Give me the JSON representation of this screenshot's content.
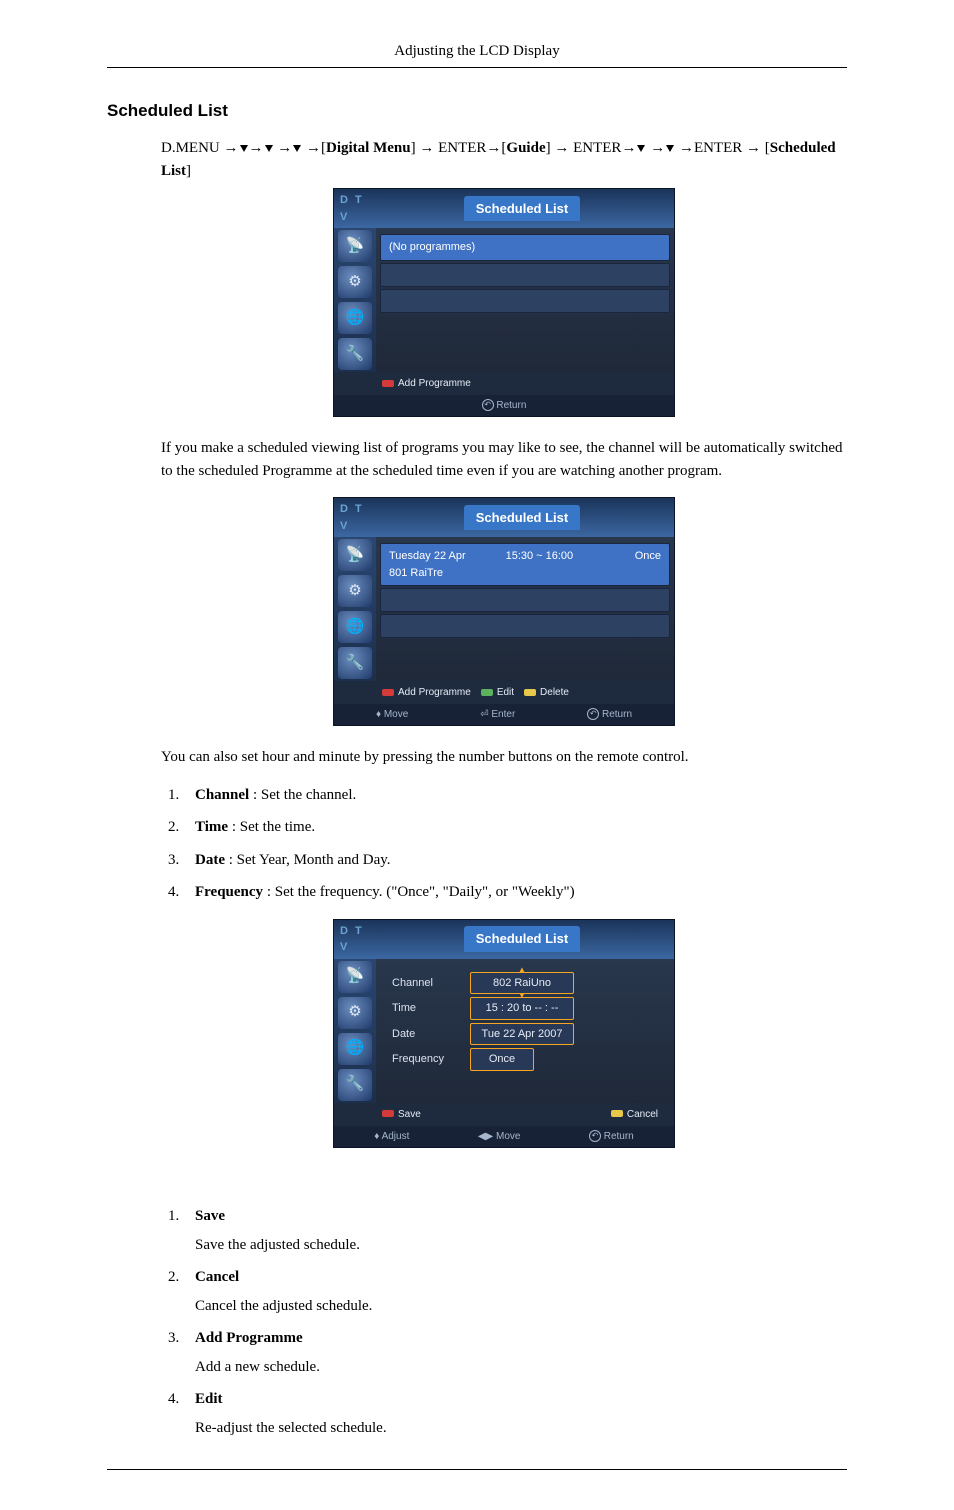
{
  "header": {
    "title": "Adjusting the LCD Display"
  },
  "section": {
    "title": "Scheduled List"
  },
  "breadcrumb": {
    "dmenu": "D.MENU ",
    "digital_menu": "Digital Menu",
    "enter": "ENTER",
    "guide": "Guide",
    "scheduled_list": "Scheduled List"
  },
  "osd_common": {
    "dtv": "D T V",
    "title": "Scheduled List",
    "icons": [
      "📡",
      "⚙",
      "🌐",
      "🔧"
    ]
  },
  "osd1": {
    "no_programmes": "(No programmes)",
    "add_programme": "Add Programme",
    "return": "Return"
  },
  "text1": "If you make a scheduled viewing list of programs you may like to see, the channel will be automatically switched to the scheduled Programme at the scheduled time even if you are watching another program.",
  "osd2": {
    "row": {
      "date": "Tuesday  22  Apr",
      "channel": "801  RaiTre",
      "time": "15:30 ~ 16:00",
      "freq": "Once"
    },
    "add_programme": "Add Programme",
    "edit": "Edit",
    "delete": "Delete",
    "move": "Move",
    "enter": "Enter",
    "return": "Return"
  },
  "text2": "You can also set hour and minute by pressing the number buttons on the remote control.",
  "list1": [
    {
      "label": "Channel",
      "desc": " : Set the channel."
    },
    {
      "label": "Time",
      "desc": " : Set the time."
    },
    {
      "label": "Date",
      "desc": " : Set Year, Month and Day."
    },
    {
      "label": "Frequency",
      "desc": " : Set the frequency. (\"Once\", \"Daily\", or \"Weekly\")"
    }
  ],
  "osd3": {
    "channel": {
      "label": "Channel",
      "value": "802 RaiUno"
    },
    "time": {
      "label": "Time",
      "value": "15 : 20 to -- : --"
    },
    "date": {
      "label": "Date",
      "value": "Tue 22 Apr 2007"
    },
    "frequency": {
      "label": "Frequency",
      "value": "Once"
    },
    "save": "Save",
    "cancel": "Cancel",
    "adjust": "Adjust",
    "move": "Move",
    "return": "Return"
  },
  "list2": [
    {
      "label": "Save",
      "desc": "Save the adjusted schedule."
    },
    {
      "label": "Cancel",
      "desc": "Cancel the adjusted schedule."
    },
    {
      "label": "Add Programme",
      "desc": "Add a new schedule."
    },
    {
      "label": "Edit",
      "desc": "Re-adjust the selected schedule."
    }
  ]
}
